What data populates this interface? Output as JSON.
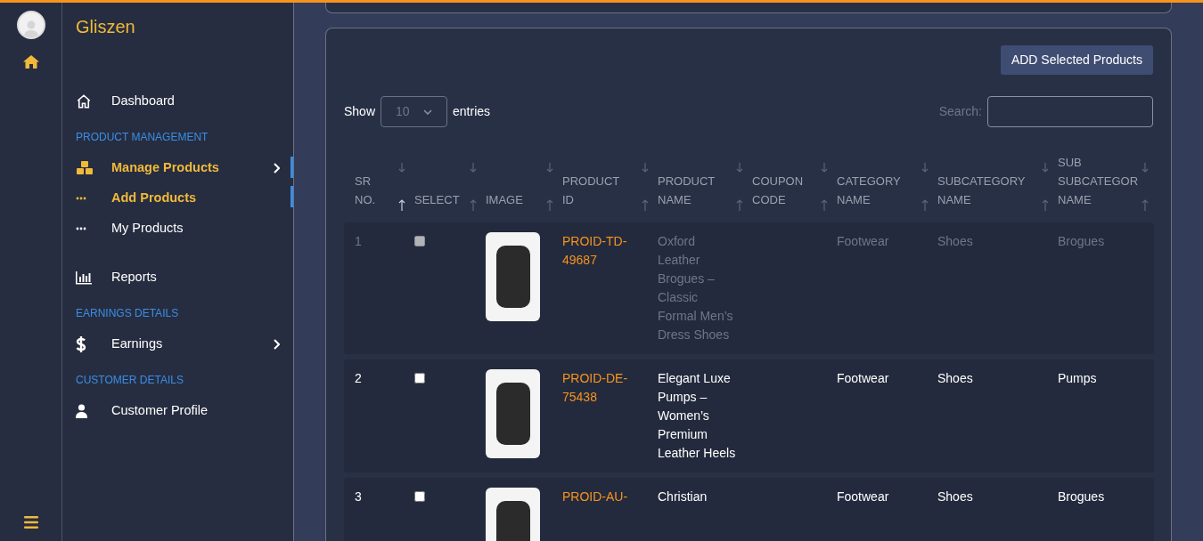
{
  "brand": "Gliszen",
  "sidebar": {
    "items": [
      {
        "kind": "link",
        "label": "Dashboard",
        "active": false,
        "expandable": false
      },
      {
        "kind": "section",
        "label": "PRODUCT MANAGEMENT"
      },
      {
        "kind": "link",
        "label": "Manage Products",
        "active": true,
        "expandable": true
      },
      {
        "kind": "sub",
        "label": "Add Products",
        "active": true
      },
      {
        "kind": "sub",
        "label": "My Products",
        "active": false
      },
      {
        "kind": "spacer"
      },
      {
        "kind": "link",
        "label": "Reports",
        "active": false,
        "expandable": false
      },
      {
        "kind": "section",
        "label": "EARNINGS DETAILS"
      },
      {
        "kind": "link",
        "label": "Earnings",
        "active": false,
        "expandable": true
      },
      {
        "kind": "section",
        "label": "CUSTOMER DETAILS"
      },
      {
        "kind": "link",
        "label": "Customer Profile",
        "active": false,
        "expandable": false
      }
    ]
  },
  "add_button": "ADD Selected Products",
  "length": {
    "show": "Show",
    "value": "10",
    "entries": "entries"
  },
  "search": {
    "label": "Search:"
  },
  "table": {
    "columns": [
      {
        "label": "SR NO.",
        "sorted": true
      },
      {
        "label": "SELECT",
        "sorted": false
      },
      {
        "label": "IMAGE",
        "sorted": false
      },
      {
        "label": "PRODUCT ID",
        "sorted": false
      },
      {
        "label": "PRODUCT NAME",
        "sorted": false
      },
      {
        "label": "COUPON CODE",
        "sorted": false
      },
      {
        "label": "CATEGORY NAME",
        "sorted": false
      },
      {
        "label": "SUBCATEGORY NAME",
        "sorted": false
      },
      {
        "label": "SUB SUBCATEGOR NAME",
        "sorted": false
      }
    ],
    "rows": [
      {
        "sr": "1",
        "checked": false,
        "disabled": true,
        "product_id": "PROID-TD-49687",
        "name": "Oxford Leather Brogues – Classic Formal Men’s Dress Shoes",
        "category": "Footwear",
        "subcategory": "Shoes",
        "subsubcategory": "Brogues"
      },
      {
        "sr": "2",
        "checked": false,
        "disabled": false,
        "product_id": "PROID-DE-75438",
        "name": "Elegant Luxe Pumps – Women’s Premium Leather Heels",
        "category": "Footwear",
        "subcategory": "Shoes",
        "subsubcategory": "Pumps"
      },
      {
        "sr": "3",
        "checked": false,
        "disabled": false,
        "product_id": "PROID-AU-",
        "name": "Christian",
        "category": "Footwear",
        "subcategory": "Shoes",
        "subsubcategory": "Brogues"
      }
    ]
  }
}
